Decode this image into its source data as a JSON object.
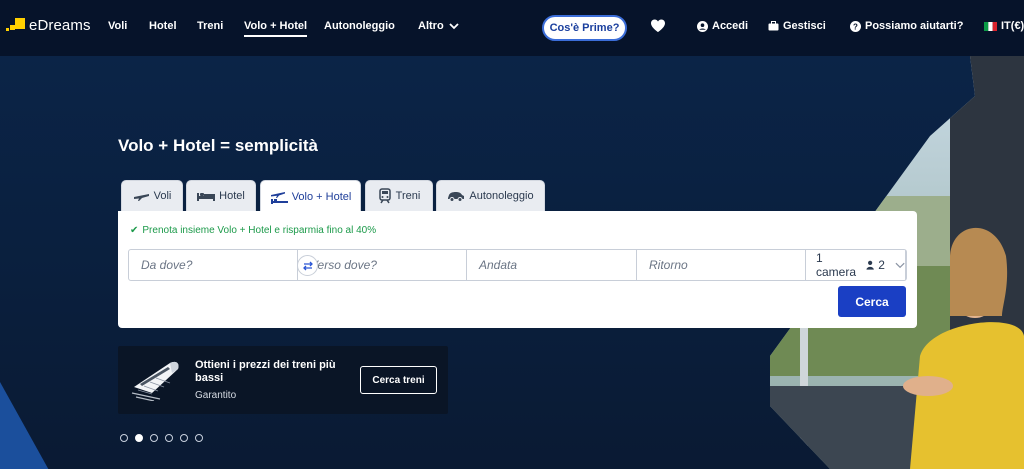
{
  "brand": {
    "name": "eDreams",
    "accent": "#ffd000"
  },
  "nav": {
    "links": [
      "Voli",
      "Hotel",
      "Treni",
      "Volo + Hotel",
      "Autonoleggio",
      "Altro"
    ],
    "active": "Volo + Hotel",
    "prime_label": "Cos'è Prime?",
    "login_label": "Accedi",
    "manage_label": "Gestisci",
    "help_label": "Possiamo aiutarti?",
    "locale_label": "IT(€)"
  },
  "hero": {
    "title": "Volo + Hotel = semplicità"
  },
  "tabs": [
    "Voli",
    "Hotel",
    "Volo + Hotel",
    "Treni",
    "Autonoleggio"
  ],
  "search": {
    "promo": "Prenota insieme Volo + Hotel e risparmia fino al 40%",
    "from_placeholder": "Da dove?",
    "to_placeholder": "Verso dove?",
    "depart_placeholder": "Andata",
    "return_placeholder": "Ritorno",
    "rooms_label": "1 camera",
    "guests": "2",
    "submit_label": "Cerca"
  },
  "train_banner": {
    "title": "Ottieni i prezzi dei treni più bassi",
    "subtitle": "Garantito",
    "button_label": "Cerca treni"
  },
  "carousel": {
    "total": 6,
    "active_index": 1
  },
  "colors": {
    "primary_button": "#1a3fc4",
    "promo_green": "#1c9a4a",
    "background": "#0b1e3a"
  }
}
